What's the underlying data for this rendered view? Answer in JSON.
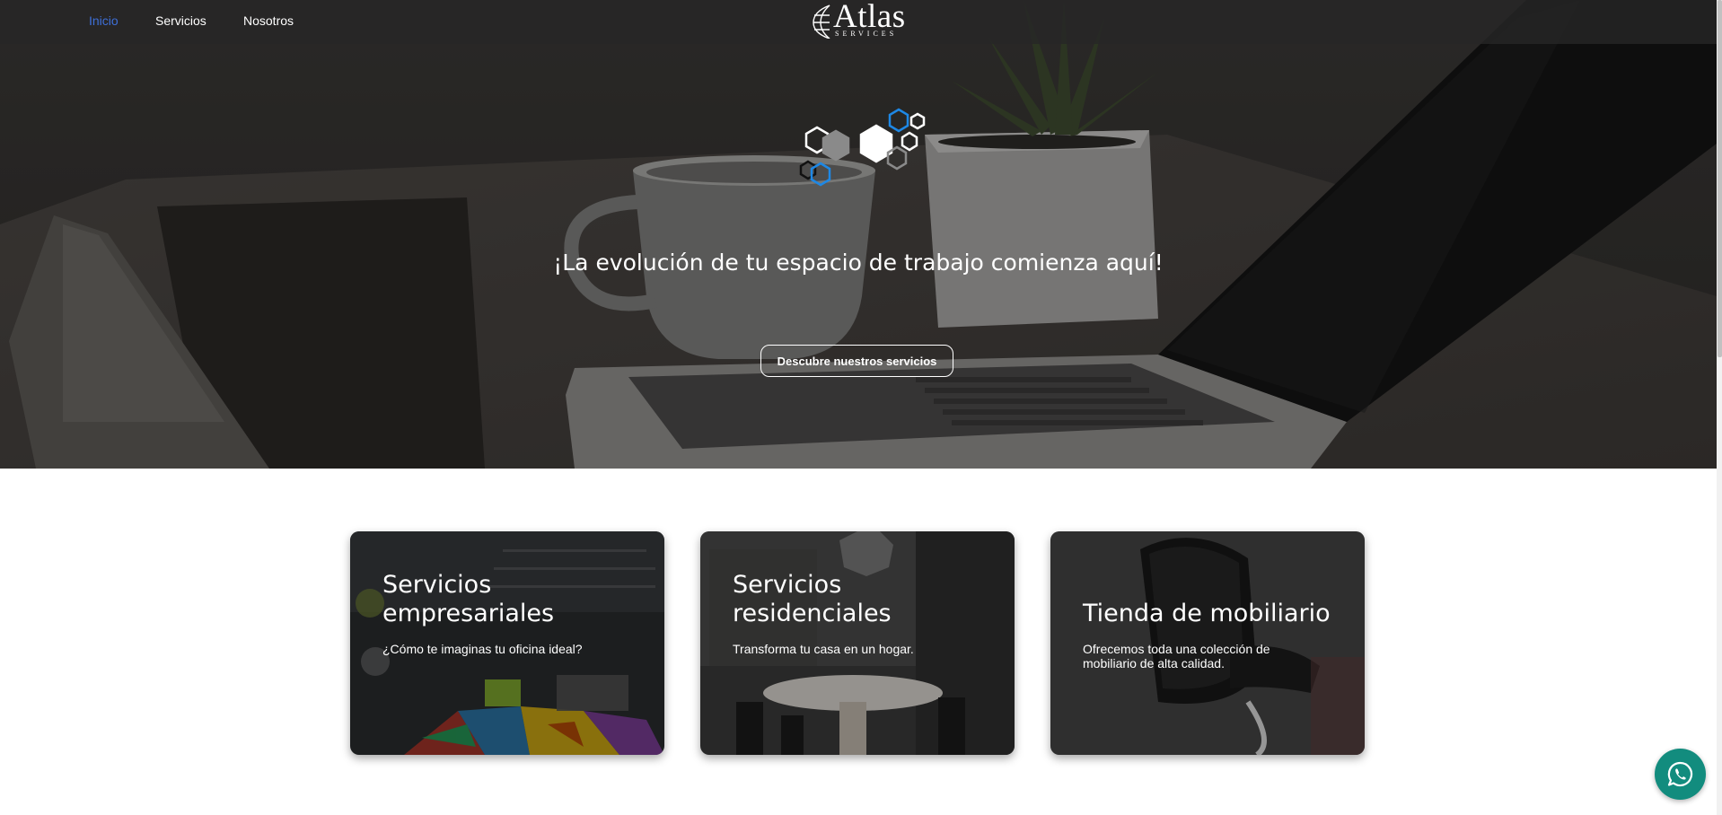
{
  "nav": {
    "items": [
      {
        "label": "Inicio",
        "active": true
      },
      {
        "label": "Servicios",
        "active": false
      },
      {
        "label": "Nosotros",
        "active": false
      }
    ],
    "active_color": "#3e6fd8"
  },
  "brand": {
    "name": "Atlas",
    "subtitle": "SERVICES"
  },
  "hero": {
    "title": "¡La evolución de tu espacio de trabajo comienza aquí!",
    "button_label": "Descubre nuestros servicios",
    "icons": [
      "hexagon-cluster-icon"
    ]
  },
  "cards": [
    {
      "title": "Servicios empresariales",
      "text": "¿Cómo te imaginas tu oficina ideal?"
    },
    {
      "title": "Servicios residenciales",
      "text": "Transforma tu casa en un hogar."
    },
    {
      "title": "Tienda de mobiliario",
      "text": "Ofrecemos toda una colección de mobiliario de alta calidad."
    }
  ],
  "whatsapp": {
    "icon": "whatsapp-icon",
    "color": "#128c7e"
  },
  "colors": {
    "accent_blue": "#1e88e5",
    "hero_overlay": "#2d2b29"
  }
}
